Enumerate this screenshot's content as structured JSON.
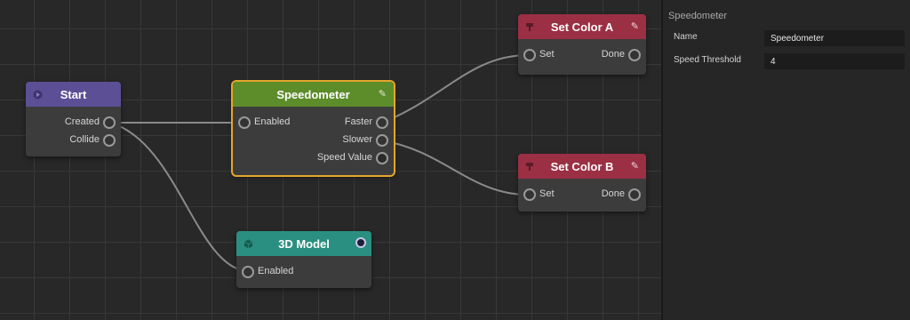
{
  "nodes": {
    "start": {
      "title": "Start",
      "color": "#5c4f96",
      "icon": "play-circle-icon",
      "outputs": [
        "Created",
        "Collide"
      ]
    },
    "speedometer": {
      "title": "Speedometer",
      "color": "#5d8c2a",
      "icon": "pencil-icon",
      "inputs": [
        "Enabled"
      ],
      "outputs": [
        "Faster",
        "Slower",
        "Speed Value"
      ],
      "selected": true
    },
    "set_color_a": {
      "title": "Set Color A",
      "color": "#9b2f44",
      "icon": "paint-roller-icon",
      "inputs": [
        "Set"
      ],
      "outputs": [
        "Done"
      ]
    },
    "set_color_b": {
      "title": "Set Color B",
      "color": "#9b2f44",
      "icon": "paint-roller-icon",
      "inputs": [
        "Set"
      ],
      "outputs": [
        "Done"
      ]
    },
    "model_3d": {
      "title": "3D Model",
      "color": "#2a8f80",
      "icon": "cube-icon",
      "inputs": [
        "Enabled"
      ]
    }
  },
  "connections": [
    {
      "from": "start.Created",
      "to": "speedometer.Enabled"
    },
    {
      "from": "start.Created",
      "to": "model_3d.Enabled"
    },
    {
      "from": "speedometer.Faster",
      "to": "set_color_a.Set"
    },
    {
      "from": "speedometer.Slower",
      "to": "set_color_b.Set"
    }
  ],
  "inspector": {
    "title": "Speedometer",
    "fields": [
      {
        "label": "Name",
        "value": "Speedometer"
      },
      {
        "label": "Speed Threshold",
        "value": "4"
      }
    ]
  },
  "colors": {
    "selection": "#e6a52a",
    "wire": "#8a8a8a"
  }
}
